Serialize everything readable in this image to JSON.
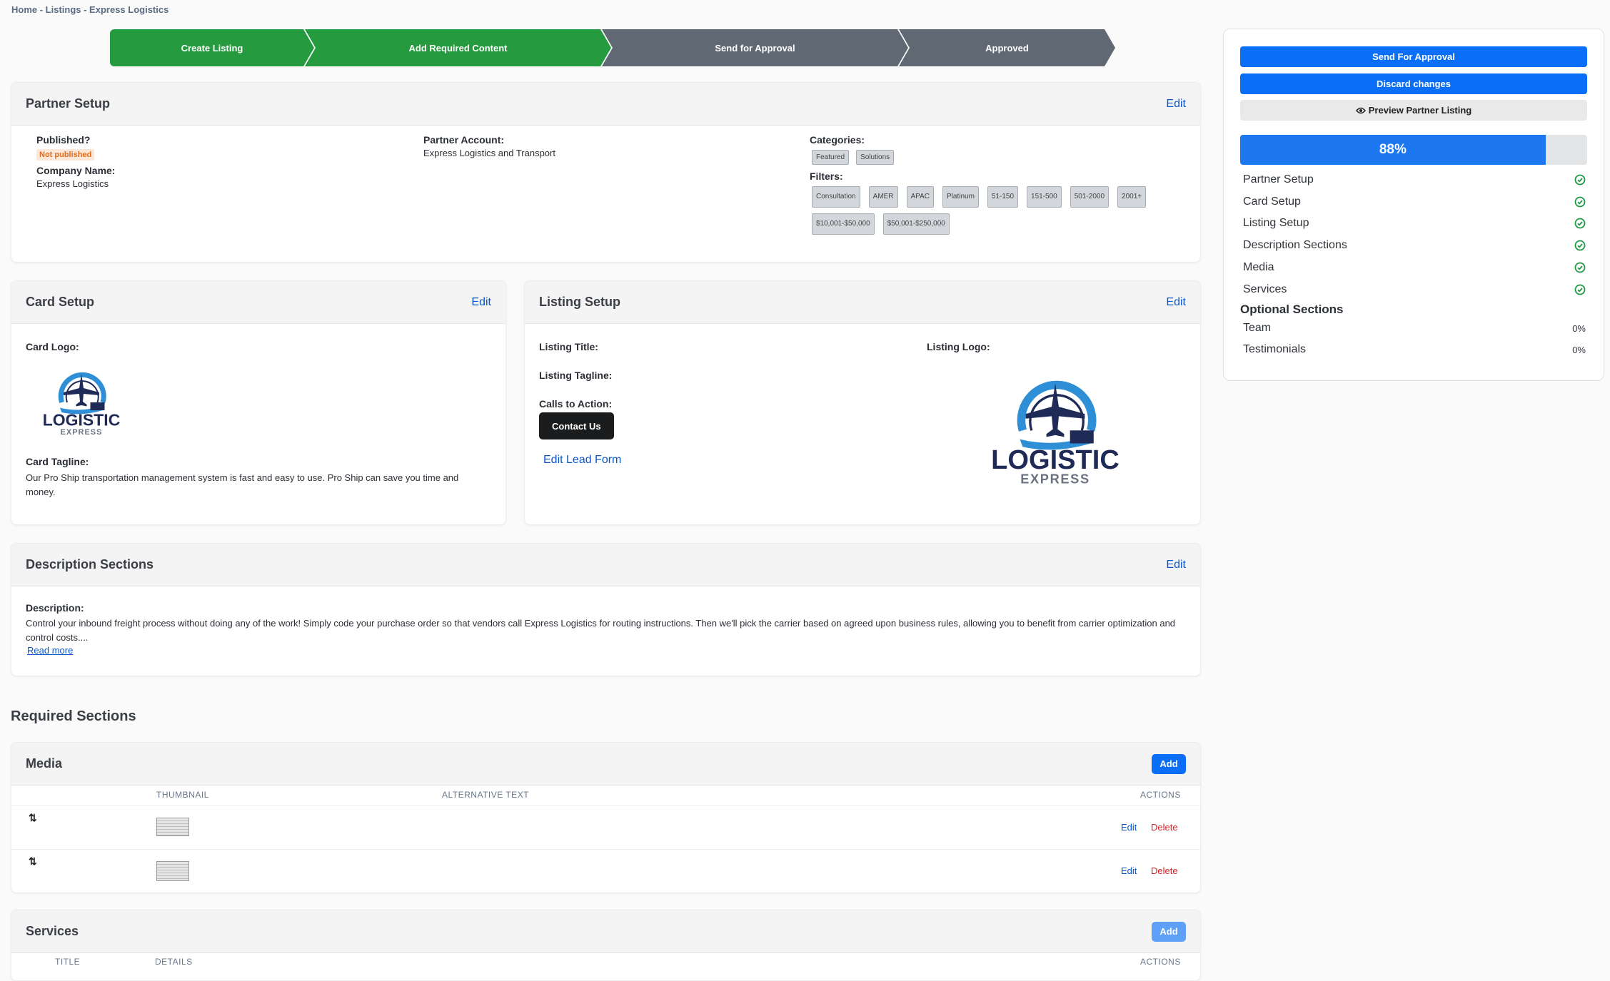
{
  "breadcrumb": "Home - Listings - Express Logistics",
  "stepper": [
    {
      "label": "Create Listing",
      "state": "done"
    },
    {
      "label": "Add Required Content",
      "state": "done"
    },
    {
      "label": "Send for Approval",
      "state": "todo"
    },
    {
      "label": "Approved",
      "state": "todo"
    }
  ],
  "partner_setup": {
    "title": "Partner Setup",
    "edit": "Edit",
    "published_label": "Published?",
    "published_value": "Not published",
    "company_label": "Company Name:",
    "company_value": "Express Logistics",
    "account_label": "Partner Account:",
    "account_value": "Express Logistics and Transport",
    "categories_label": "Categories:",
    "categories": [
      "Featured",
      "Solutions"
    ],
    "filters_label": "Filters:",
    "filters": [
      "Consultation",
      "AMER",
      "APAC",
      "Platinum",
      "51-150",
      "151-500",
      "501-2000",
      "2001+",
      "$10,001-$50,000",
      "$50,001-$250,000"
    ]
  },
  "card_setup": {
    "title": "Card Setup",
    "edit": "Edit",
    "logo_label": "Card Logo:",
    "tagline_label": "Card Tagline:",
    "tagline_value": "Our Pro Ship transportation management system is fast and easy to use. Pro Ship can save you time and money."
  },
  "logo": {
    "word1": "LOGISTIC",
    "word2": "EXPRESS"
  },
  "listing_setup": {
    "title": "Listing Setup",
    "edit": "Edit",
    "title_label": "Listing Title:",
    "tagline_label": "Listing Tagline:",
    "cta_label": "Calls to Action:",
    "cta_button": "Contact Us",
    "lead_form_link": "Edit Lead Form",
    "logo_label": "Listing Logo:"
  },
  "description": {
    "title": "Description Sections",
    "edit": "Edit",
    "label": "Description:",
    "text": "Control your inbound freight process without doing any of the work! Simply code your purchase order so that vendors call Express Logistics for routing instructions. Then we'll pick the carrier based on agreed upon business rules, allowing you to benefit from carrier optimization and control costs....",
    "read_more": "Read more"
  },
  "required_sections": {
    "heading": "Required Sections",
    "media": {
      "title": "Media",
      "add": "Add",
      "columns": {
        "thumbnail": "THUMBNAIL",
        "alt": "ALTERNATIVE TEXT",
        "actions": "ACTIONS"
      },
      "rows": [
        {
          "edit": "Edit",
          "delete": "Delete"
        },
        {
          "edit": "Edit",
          "delete": "Delete"
        }
      ]
    },
    "services": {
      "title": "Services",
      "add": "Add",
      "columns": {
        "title": "TITLE",
        "details": "DETAILS",
        "actions": "ACTIONS"
      }
    }
  },
  "sidebar": {
    "send_button": "Send For Approval",
    "discard_button": "Discard changes",
    "preview_button": "Preview Partner Listing",
    "progress_percent": 88,
    "progress_label": "88%",
    "checklist": [
      {
        "label": "Partner Setup"
      },
      {
        "label": "Card Setup"
      },
      {
        "label": "Listing Setup"
      },
      {
        "label": "Description Sections"
      },
      {
        "label": "Media"
      },
      {
        "label": "Services"
      }
    ],
    "optional_heading": "Optional Sections",
    "optional": [
      {
        "label": "Team",
        "value": "0%"
      },
      {
        "label": "Testimonials",
        "value": "0%"
      }
    ]
  },
  "colors": {
    "accent": "#0b6ef7",
    "done": "#259a3f",
    "todo": "#606973",
    "danger": "#d1232b",
    "check": "#1f9a44"
  }
}
